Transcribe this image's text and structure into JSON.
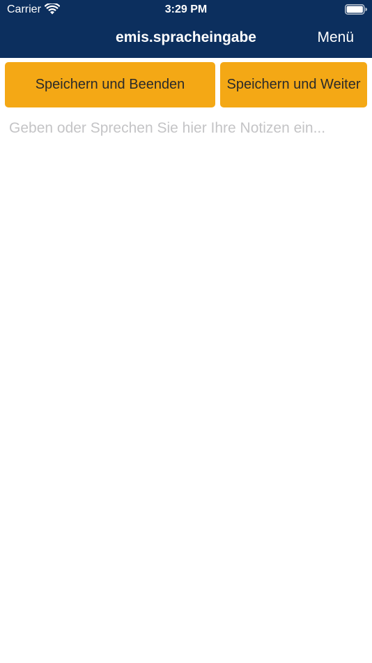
{
  "status_bar": {
    "carrier": "Carrier",
    "time": "3:29 PM",
    "wifi_icon": "wifi-icon",
    "battery_icon": "battery-icon"
  },
  "nav": {
    "title": "emis.spracheingabe",
    "menu_label": "Menü"
  },
  "actions": {
    "save_and_exit_label": "Speichern und Beenden",
    "save_and_continue_label": "Speichern und Weiter"
  },
  "notes": {
    "value": "",
    "placeholder": "Geben oder Sprechen Sie hier Ihre Notizen ein..."
  },
  "colors": {
    "nav_background": "#0c2f5e",
    "button_background": "#f4a815",
    "button_text": "#2a2a2a",
    "placeholder": "#c4c4c6"
  }
}
